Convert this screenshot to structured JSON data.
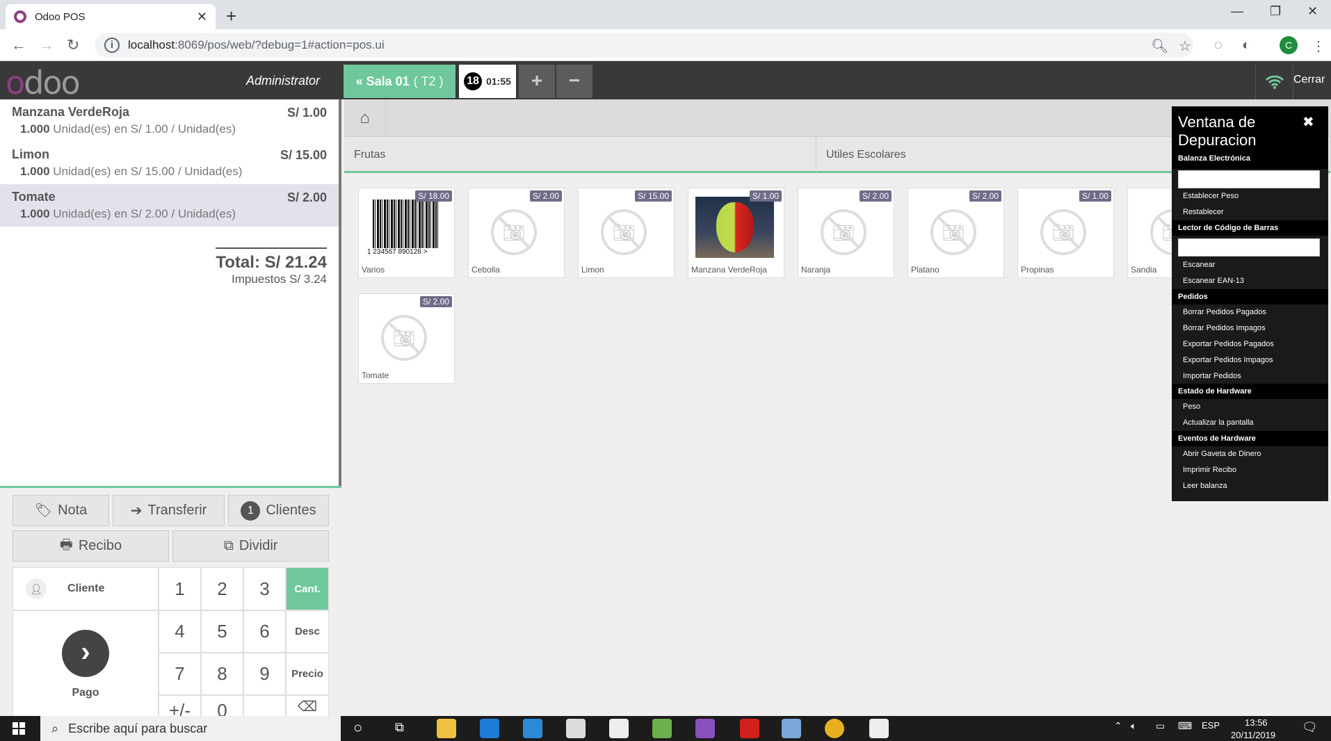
{
  "browser": {
    "tab_title": "Odoo POS",
    "url_host": "localhost",
    "url_rest": ":8069/pos/web/?debug=1#action=pos.ui",
    "profile_initial": "C"
  },
  "header": {
    "logo": "odoo",
    "user": "Administrator",
    "floor_button": "Sala 01",
    "table": "( T2 )",
    "order_guests": "18",
    "order_time": "01:55",
    "add": "+",
    "remove": "−",
    "close": "Cerrar"
  },
  "order": {
    "lines": [
      {
        "name": "Manzana VerdeRoja",
        "price": "S/ 1.00",
        "qty": "1.000",
        "detail": "Unidad(es) en S/ 1.00 / Unidad(es)"
      },
      {
        "name": "Limon",
        "price": "S/ 15.00",
        "qty": "1.000",
        "detail": "Unidad(es) en S/ 15.00 / Unidad(es)"
      },
      {
        "name": "Tomate",
        "price": "S/ 2.00",
        "qty": "1.000",
        "detail": "Unidad(es) en S/ 2.00 / Unidad(es)"
      }
    ],
    "total": "Total: S/ 21.24",
    "taxes": "Impuestos S/ 3.24"
  },
  "actions": {
    "note": "Nota",
    "transfer": "Transferir",
    "guests_count": "1",
    "guests": "Clientes",
    "receipt": "Recibo",
    "split": "Dividir",
    "customer": "Cliente",
    "payment": "Pago"
  },
  "numpad": {
    "keys": [
      "1",
      "2",
      "3",
      "4",
      "5",
      "6",
      "7",
      "8",
      "9",
      "+/-",
      "0"
    ],
    "qty": "Cant.",
    "disc": "Desc",
    "price": "Precio"
  },
  "categories": [
    "Frutas",
    "Utiles Escolares"
  ],
  "products": [
    {
      "name": "Varios",
      "price": "S/ 18.00"
    },
    {
      "name": "Cebolla",
      "price": "S/ 2.00"
    },
    {
      "name": "Limon",
      "price": "S/ 15.00"
    },
    {
      "name": "Manzana VerdeRoja",
      "price": "S/ 1.00"
    },
    {
      "name": "Naranja",
      "price": "S/ 2.00"
    },
    {
      "name": "Platano",
      "price": "S/ 2.00"
    },
    {
      "name": "Propinas",
      "price": "S/ 1.00"
    },
    {
      "name": "Sandia",
      "price": ""
    },
    {
      "name": "Tomate",
      "price": "S/ 2.00"
    }
  ],
  "barcode_text": "1  234567  890128  >",
  "debug": {
    "title": "Ventana de Depuracion",
    "sections": {
      "scale": "Balanza Electrónica",
      "barcode": "Lector de Código de Barras",
      "orders": "Pedidos",
      "hw_status": "Estado de Hardware",
      "hw_events": "Eventos de Hardware"
    },
    "items": {
      "set_weight": "Establecer Peso",
      "reset": "Restablecer",
      "scan": "Escanear",
      "scan_ean": "Escanear EAN-13",
      "del_paid": "Borrar Pedidos Pagados",
      "del_unpaid": "Borrar Pedidos Impagos",
      "exp_paid": "Exportar Pedidos Pagados",
      "exp_unpaid": "Exportar Pedidos Impagos",
      "import": "Importar Pedidos",
      "weight": "Peso",
      "refresh": "Actualizar la pantalla",
      "cashbox": "Abrir Gaveta de Dinero",
      "print": "Imprimir Recibo",
      "read_scale": "Leer balanza"
    }
  },
  "taskbar": {
    "search_placeholder": "Escribe aquí para buscar",
    "lang": "ESP",
    "time": "13:56",
    "date": "20/11/2019"
  }
}
